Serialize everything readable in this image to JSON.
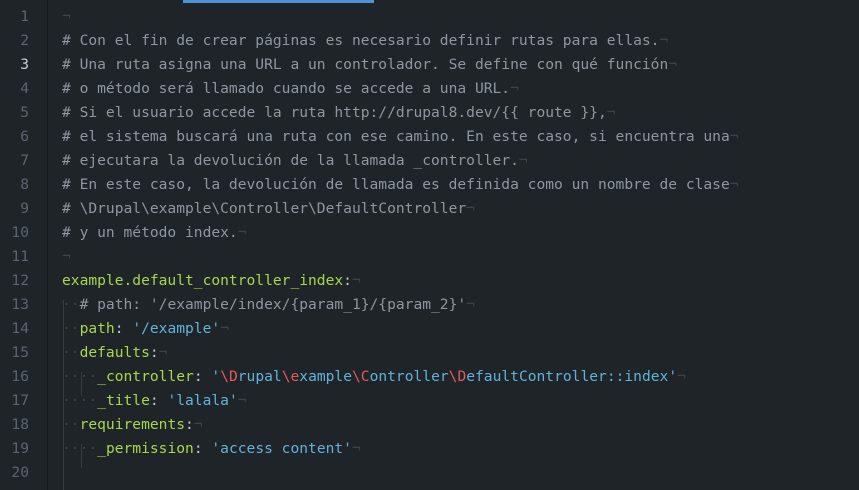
{
  "editor": {
    "active_line": 3,
    "eol_marker": "¬",
    "indent_dot": "·",
    "lines": [
      {
        "num": "1",
        "segments": []
      },
      {
        "num": "2",
        "segments": [
          {
            "cls": "c-comment",
            "text": "# Con el fin de crear páginas es necesario definir rutas para ellas."
          }
        ]
      },
      {
        "num": "3",
        "segments": [
          {
            "cls": "c-comment",
            "text": "# Una ruta asigna una URL a un controlador. Se define con qué función"
          }
        ]
      },
      {
        "num": "4",
        "segments": [
          {
            "cls": "c-comment",
            "text": "# o método será llamado cuando se accede a una URL."
          }
        ]
      },
      {
        "num": "5",
        "segments": [
          {
            "cls": "c-comment",
            "text": "# Si el usuario accede la ruta http://drupal8.dev/{{ route }},"
          }
        ]
      },
      {
        "num": "6",
        "segments": [
          {
            "cls": "c-comment",
            "text": "# el sistema buscará una ruta con ese camino. En este caso, si encuentra una"
          }
        ]
      },
      {
        "num": "7",
        "segments": [
          {
            "cls": "c-comment",
            "text": "# ejecutara la devolución de la llamada _controller."
          }
        ]
      },
      {
        "num": "8",
        "segments": [
          {
            "cls": "c-comment",
            "text": "# En este caso, la devolución de llamada es definida como un nombre de clase"
          }
        ]
      },
      {
        "num": "9",
        "segments": [
          {
            "cls": "c-comment",
            "text": "# \\Drupal\\example\\Controller\\DefaultController"
          }
        ]
      },
      {
        "num": "10",
        "segments": [
          {
            "cls": "c-comment",
            "text": "# y un método index."
          }
        ]
      },
      {
        "num": "11",
        "segments": []
      },
      {
        "num": "12",
        "segments": [
          {
            "cls": "c-key",
            "text": "example.default_controller_index"
          },
          {
            "cls": "c-punct",
            "text": ":"
          }
        ]
      },
      {
        "num": "13",
        "segments": [
          {
            "cls": "c-inv",
            "text": "··"
          },
          {
            "cls": "c-comment",
            "text": "# path: '/example/index/{param_1}/{param_2}'"
          }
        ]
      },
      {
        "num": "14",
        "segments": [
          {
            "cls": "c-inv",
            "text": "··"
          },
          {
            "cls": "c-key",
            "text": "path"
          },
          {
            "cls": "c-punct",
            "text": ": "
          },
          {
            "cls": "c-str",
            "text": "'/example'"
          }
        ]
      },
      {
        "num": "15",
        "segments": [
          {
            "cls": "c-inv",
            "text": "··"
          },
          {
            "cls": "c-key",
            "text": "defaults"
          },
          {
            "cls": "c-punct",
            "text": ":"
          }
        ]
      },
      {
        "num": "16",
        "segments": [
          {
            "cls": "c-inv",
            "text": "····"
          },
          {
            "cls": "c-key",
            "text": "_controller"
          },
          {
            "cls": "c-punct",
            "text": ": "
          },
          {
            "cls": "c-str",
            "text": "'"
          },
          {
            "cls": "c-bs",
            "text": "\\D"
          },
          {
            "cls": "c-str",
            "text": "rupal"
          },
          {
            "cls": "c-bs",
            "text": "\\e"
          },
          {
            "cls": "c-str",
            "text": "xample"
          },
          {
            "cls": "c-bs",
            "text": "\\C"
          },
          {
            "cls": "c-str",
            "text": "ontroller"
          },
          {
            "cls": "c-bs",
            "text": "\\D"
          },
          {
            "cls": "c-str",
            "text": "efaultController::index'"
          }
        ]
      },
      {
        "num": "17",
        "segments": [
          {
            "cls": "c-inv",
            "text": "····"
          },
          {
            "cls": "c-key",
            "text": "_title"
          },
          {
            "cls": "c-punct",
            "text": ": "
          },
          {
            "cls": "c-str",
            "text": "'lalala'"
          }
        ]
      },
      {
        "num": "18",
        "segments": [
          {
            "cls": "c-inv",
            "text": "··"
          },
          {
            "cls": "c-key",
            "text": "requirements"
          },
          {
            "cls": "c-punct",
            "text": ":"
          }
        ]
      },
      {
        "num": "19",
        "segments": [
          {
            "cls": "c-inv",
            "text": "····"
          },
          {
            "cls": "c-key",
            "text": "_permission"
          },
          {
            "cls": "c-punct",
            "text": ": "
          },
          {
            "cls": "c-str",
            "text": "'access content'"
          }
        ]
      },
      {
        "num": "20",
        "segments": []
      }
    ]
  }
}
